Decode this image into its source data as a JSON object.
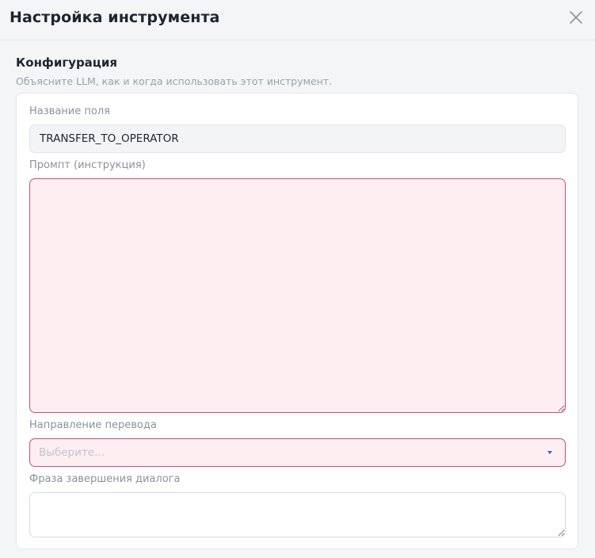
{
  "dialog": {
    "title": "Настройка инструмента",
    "close_icon": "close-icon"
  },
  "section": {
    "title": "Конфигурация",
    "subtitle": "Объясните LLM, как и когда использовать этот инструмент."
  },
  "fields": {
    "field_name": {
      "label": "Название поля",
      "value": "TRANSFER_TO_OPERATOR"
    },
    "prompt": {
      "label": "Промпт (инструкция)",
      "value": ""
    },
    "direction": {
      "label": "Направление перевода",
      "placeholder": "Выберите...",
      "arrow_icon": "caret-down-icon"
    },
    "end_phrase": {
      "label": "Фраза завершения диалога",
      "value": ""
    }
  },
  "colors": {
    "background": "#f4f5f7",
    "card": "#ffffff",
    "error_border": "#c84b7f",
    "error_fill": "#fdeef2",
    "accent_blue": "#3b5bdb",
    "muted_text": "#8b919c"
  }
}
